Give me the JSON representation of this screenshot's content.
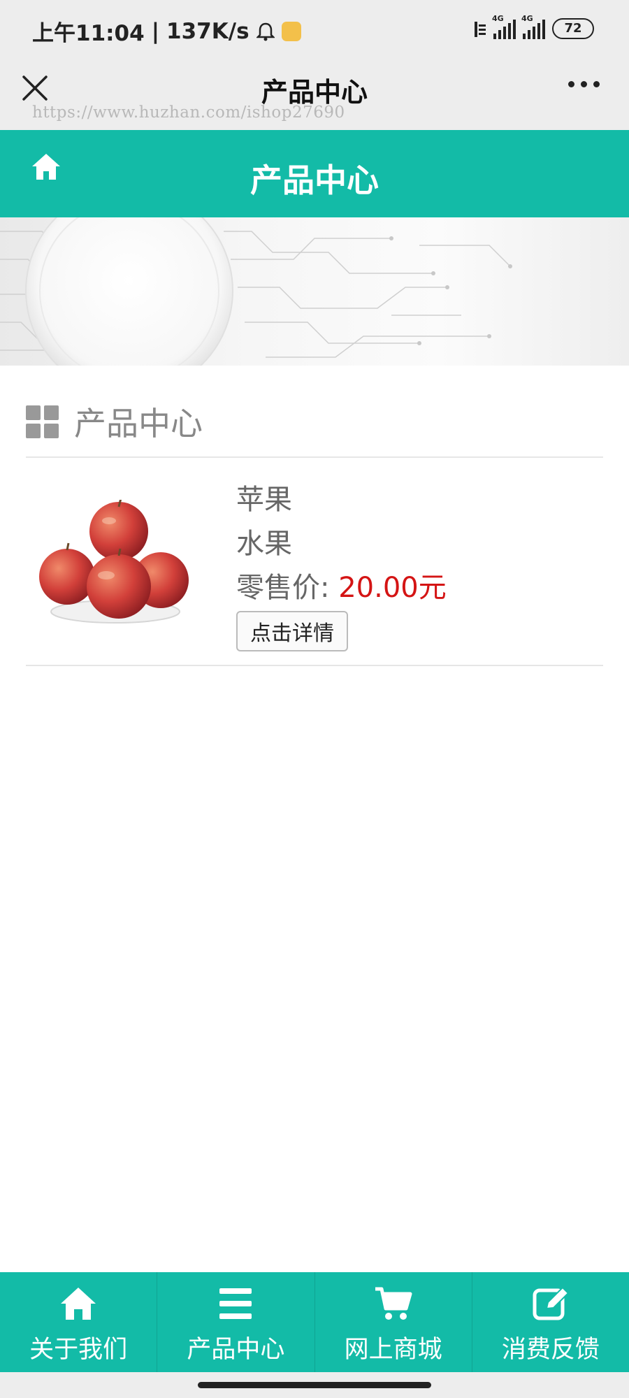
{
  "status_bar": {
    "time": "上午11:04",
    "net_speed": "137K/s",
    "signal_1_label": "4G",
    "signal_2_label": "4G",
    "battery": "72"
  },
  "title_bar": {
    "title": "产品中心",
    "watermark": "https://www.huzhan.com/ishop27690"
  },
  "header": {
    "title": "产品中心"
  },
  "section": {
    "title": "产品中心"
  },
  "product": {
    "name": "苹果",
    "category": "水果",
    "price_label": "零售价:",
    "price": "20.00元",
    "detail_button": "点击详情",
    "image_icon": "apple-plate-image"
  },
  "bottom_nav": [
    {
      "label": "关于我们",
      "icon": "home-icon"
    },
    {
      "label": "产品中心",
      "icon": "list-icon"
    },
    {
      "label": "网上商城",
      "icon": "cart-icon"
    },
    {
      "label": "消费反馈",
      "icon": "edit-icon"
    }
  ],
  "colors": {
    "accent": "#13bba7",
    "price": "#d41414",
    "chrome": "#ededed"
  }
}
